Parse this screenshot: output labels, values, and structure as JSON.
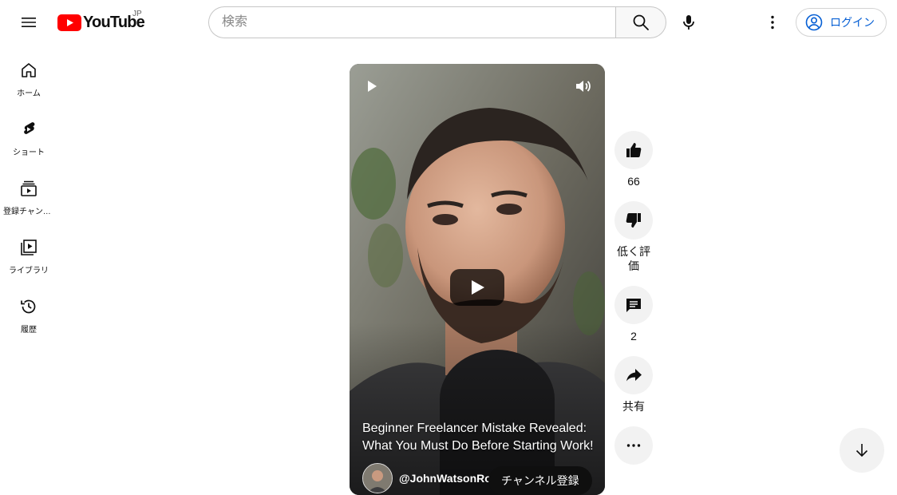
{
  "header": {
    "menu_icon": "hamburger-menu-icon",
    "logo_text": "YouTube",
    "region": "JP",
    "search_placeholder": "検索",
    "search_value": "",
    "login_label": "ログイン"
  },
  "sidebar": {
    "items": [
      {
        "label": "ホーム",
        "icon": "home-icon"
      },
      {
        "label": "ショート",
        "icon": "shorts-icon"
      },
      {
        "label": "登録チャンネル",
        "icon": "subscriptions-icon"
      },
      {
        "label": "ライブラリ",
        "icon": "library-icon"
      },
      {
        "label": "履歴",
        "icon": "history-icon"
      }
    ]
  },
  "video": {
    "title": "Beginner Freelancer Mistake Revealed: What You Must Do Before Starting Work!",
    "channel": "@JohnWatsonRoo",
    "subscribe_label": "チャンネル登録"
  },
  "actions": {
    "likes": "66",
    "dislike_label": "低く評価",
    "comments": "2",
    "share_label": "共有"
  },
  "colors": {
    "brand_red": "#ff0000",
    "link_blue": "#065fd4",
    "chip_bg": "#f2f2f2"
  }
}
